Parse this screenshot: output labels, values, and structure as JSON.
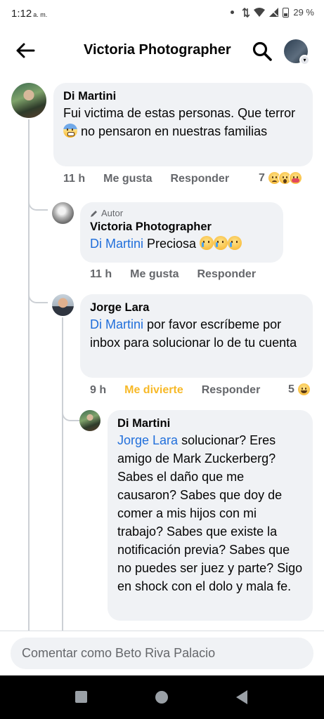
{
  "status_bar": {
    "time": "1:12",
    "ampm": "a. m.",
    "battery": "29 %"
  },
  "header": {
    "title": "Victoria Photographer"
  },
  "comments": [
    {
      "author": "Di Martini",
      "text_before_emoji": "Fui victima de estas personas. Que terror ",
      "text_after_emoji": " no pensaron en nuestras familias",
      "time": "11 h",
      "like_label": "Me gusta",
      "reply_label": "Responder",
      "reaction_count": "7",
      "reactions": [
        "sad-reaction",
        "wow-reaction",
        "care-reaction"
      ]
    },
    {
      "author_tag": "Autor",
      "author": "Victoria Photographer",
      "mention": "Di Martini",
      "text": "Preciosa",
      "time": "11 h",
      "like_label": "Me gusta",
      "reply_label": "Responder"
    },
    {
      "author": "Jorge Lara",
      "mention": "Di Martini",
      "text": "por favor escríbeme por inbox para solucionar lo de tu cuenta",
      "time": "9 h",
      "like_label": "Me divierte",
      "reply_label": "Responder",
      "reaction_count": "5",
      "reactions": [
        "haha-reaction"
      ]
    },
    {
      "author": "Di Martini",
      "mention": "Jorge Lara",
      "text": "solucionar? Eres amigo de Mark Zuckerberg? Sabes el daño que me causaron? Sabes que doy de comer a mis hijos con mi trabajo? Sabes que existe la notificación previa? Sabes que no puedes ser juez y parte?  Sigo en shock con el dolo y mala fe."
    }
  ],
  "composer": {
    "placeholder": "Comentar como Beto Riva Palacio"
  },
  "colors": {
    "mention": "#216fdb",
    "haha_action": "#f7b928",
    "bubble": "#f0f2f5",
    "secondary_text": "#65676b"
  }
}
